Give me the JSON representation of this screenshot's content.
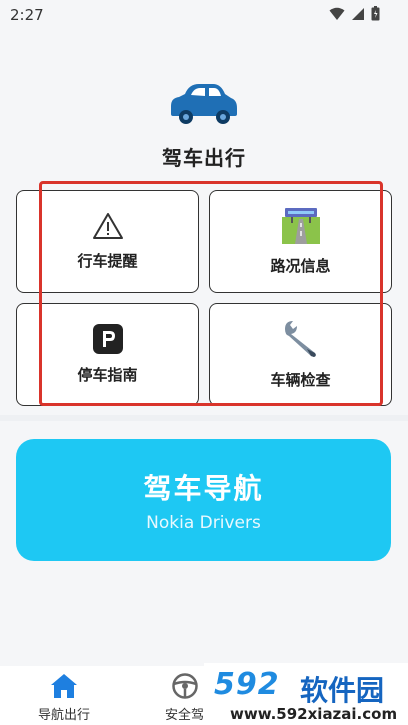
{
  "status": {
    "time": "2:27"
  },
  "hero": {
    "title": "驾车出行",
    "icon": "car-icon",
    "car_color": "#1f6fb5"
  },
  "cards": [
    {
      "label": "行车提醒",
      "icon": "warning-icon"
    },
    {
      "label": "路况信息",
      "icon": "road-icon"
    },
    {
      "label": "停车指南",
      "icon": "parking-icon"
    },
    {
      "label": "车辆检查",
      "icon": "wrench-icon"
    }
  ],
  "nav_button": {
    "title": "驾车导航",
    "subtitle": "Nokia Drivers",
    "color": "#1ec8f3"
  },
  "tabs": [
    {
      "label": "导航出行",
      "icon": "home-icon"
    },
    {
      "label": "安全驾",
      "icon": "steering-wheel-icon"
    }
  ],
  "watermark": {
    "logo": "592",
    "cn": "软件园",
    "url": "www.592xiazai.com"
  },
  "colors": {
    "highlight": "#d9342b",
    "accent": "#1ec8f3"
  }
}
